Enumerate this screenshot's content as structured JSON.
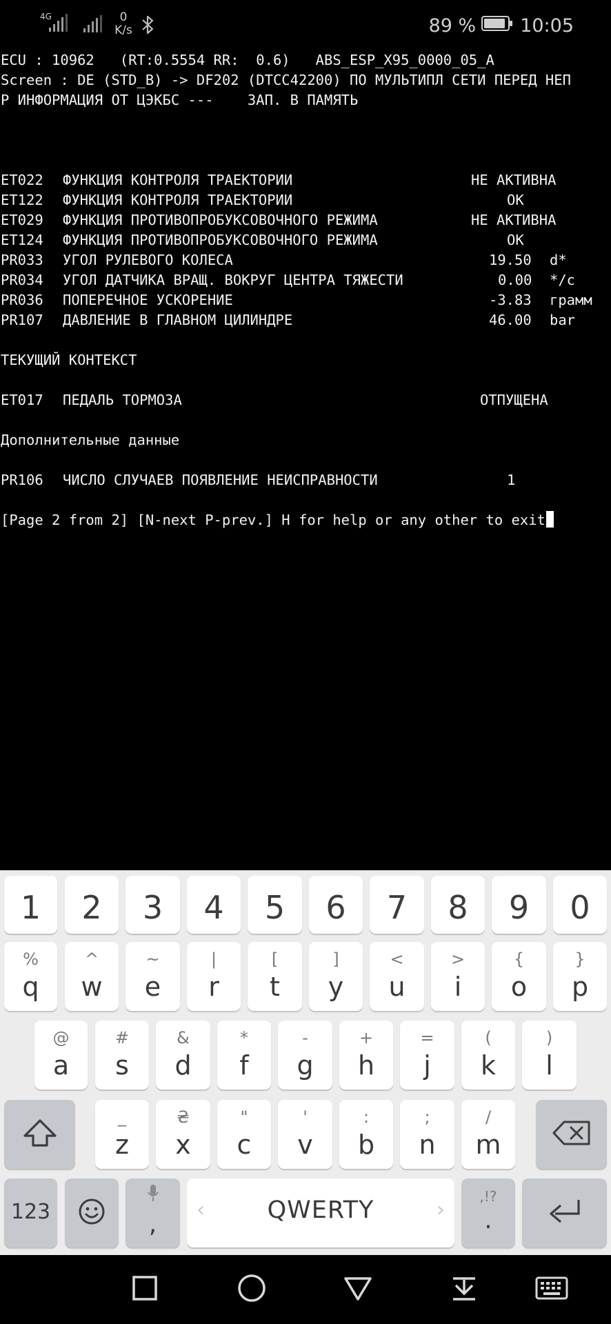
{
  "status_bar": {
    "net_type": "4G",
    "speed_value": "0",
    "speed_unit": "K/s",
    "battery_percent": "89 %",
    "time": "10:05",
    "icons": [
      "signal-4g-icon",
      "signal-icon",
      "bluetooth-icon",
      "battery-icon"
    ]
  },
  "terminal": {
    "header": [
      "ECU : 10962   (RT:0.5554 RR:  0.6)   ABS_ESP_X95_0000_05_A",
      "Screen : DE (STD_B) -> DF202 (DTCC42200) ПО МУЛЬТИПЛ СЕТИ ПЕРЕД НЕП",
      "Р ИНФОРМАЦИЯ ОТ ЦЭКБС ---    ЗАП. В ПАМЯТЬ"
    ],
    "params": [
      {
        "code": "ET022",
        "name": "ФУНКЦИЯ КОНТРОЛЯ ТРАЕКТОРИИ",
        "value": "НЕ АКТИВНА"
      },
      {
        "code": "ET122",
        "name": "ФУНКЦИЯ КОНТРОЛЯ ТРАЕКТОРИИ",
        "value": "ОК"
      },
      {
        "code": "ET029",
        "name": "ФУНКЦИЯ ПРОТИВОПРОБУКСОВОЧНОГО РЕЖИМА",
        "value": "НЕ АКТИВНА"
      },
      {
        "code": "ET124",
        "name": "ФУНКЦИЯ ПРОТИВОПРОБУКСОВОЧНОГО РЕЖИМА",
        "value": "ОК"
      },
      {
        "code": "PR033",
        "name": "УГОЛ РУЛЕВОГО КОЛЕСА",
        "value": "19.50",
        "unit": "d*"
      },
      {
        "code": "PR034",
        "name": "УГОЛ ДАТЧИКА ВРАЩ. ВОКРУГ ЦЕНТРА ТЯЖЕСТИ",
        "value": "0.00",
        "unit": "*/с"
      },
      {
        "code": "PR036",
        "name": "ПОПЕРЕЧНОЕ УСКОРЕНИЕ",
        "value": "-3.83",
        "unit": "грамм"
      },
      {
        "code": "PR107",
        "name": "ДАВЛЕНИЕ В ГЛАВНОМ ЦИЛИНДРЕ",
        "value": "46.00",
        "unit": "bar"
      }
    ],
    "context_heading": "ТЕКУЩИЙ КОНТЕКСТ",
    "context_param": {
      "code": "ET017",
      "name": "ПЕДАЛЬ ТОРМОЗА",
      "value": "ОТПУЩЕНА"
    },
    "extra_heading": "Дополнительные данные",
    "extra_param": {
      "code": "PR106",
      "name": "ЧИСЛО СЛУЧАЕВ ПОЯВЛЕНИЕ НЕИСПРАВНОСТИ",
      "value": "1"
    },
    "prompt": "[Page 2 from 2] [N-next P-prev.] H for help or any other to exit"
  },
  "keyboard": {
    "number_row": [
      "1",
      "2",
      "3",
      "4",
      "5",
      "6",
      "7",
      "8",
      "9",
      "0"
    ],
    "row1": [
      {
        "sub": "%",
        "main": "q"
      },
      {
        "sub": "^",
        "main": "w"
      },
      {
        "sub": "~",
        "main": "e"
      },
      {
        "sub": "|",
        "main": "r"
      },
      {
        "sub": "[",
        "main": "t"
      },
      {
        "sub": "]",
        "main": "y"
      },
      {
        "sub": "<",
        "main": "u"
      },
      {
        "sub": ">",
        "main": "i"
      },
      {
        "sub": "{",
        "main": "o"
      },
      {
        "sub": "}",
        "main": "p"
      }
    ],
    "row2": [
      {
        "sub": "@",
        "main": "a"
      },
      {
        "sub": "#",
        "main": "s"
      },
      {
        "sub": "&",
        "main": "d"
      },
      {
        "sub": "*",
        "main": "f"
      },
      {
        "sub": "-",
        "main": "g"
      },
      {
        "sub": "+",
        "main": "h"
      },
      {
        "sub": "=",
        "main": "j"
      },
      {
        "sub": "(",
        "main": "k"
      },
      {
        "sub": ")",
        "main": "l"
      }
    ],
    "row3": [
      {
        "sub": "_",
        "main": "z"
      },
      {
        "sub": "₴",
        "main": "x"
      },
      {
        "sub": "\"",
        "main": "c"
      },
      {
        "sub": "'",
        "main": "v"
      },
      {
        "sub": ":",
        "main": "b"
      },
      {
        "sub": ";",
        "main": "n"
      },
      {
        "sub": "/",
        "main": "m"
      }
    ],
    "symbols_label": "123",
    "comma": ",",
    "space_label": "QWERTY",
    "period": ".",
    "period_sub": ",!?",
    "special_icons": [
      "shift-icon",
      "backspace-icon",
      "emoji-icon",
      "microphone-icon",
      "enter-icon"
    ]
  },
  "nav_bar": {
    "icons": [
      "recents-square-icon",
      "home-circle-icon",
      "back-triangle-icon",
      "hide-keyboard-icon",
      "keyboard-icon"
    ]
  }
}
